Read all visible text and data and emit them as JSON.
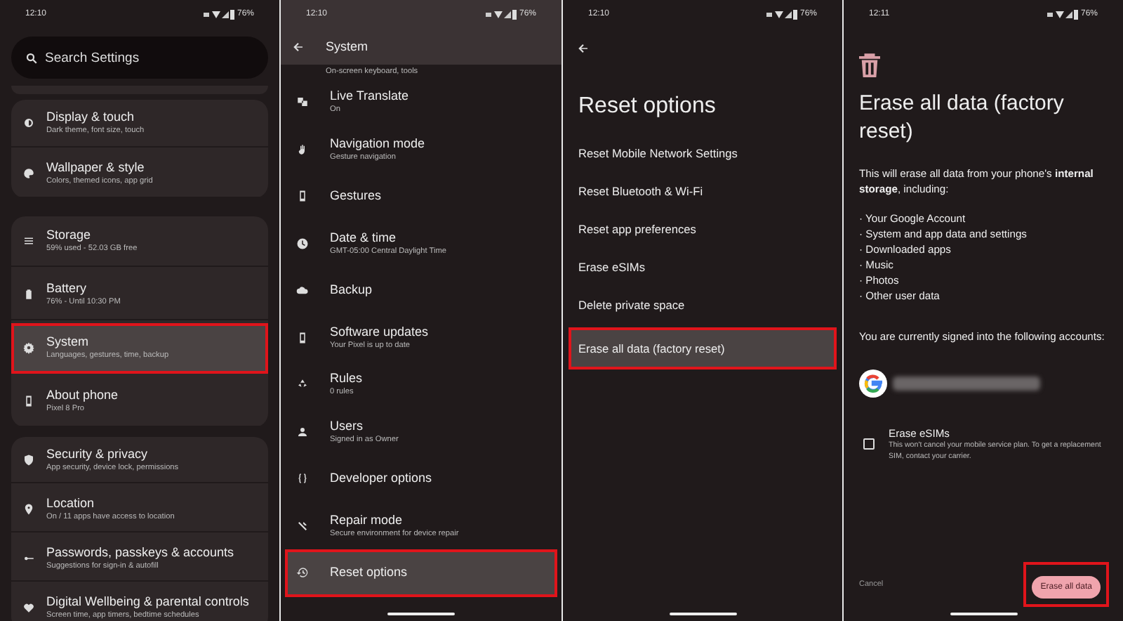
{
  "settings_screen": {
    "status_bar": {
      "time": "12:10",
      "battery": "76%"
    },
    "search": {
      "placeholder": "Search Settings"
    },
    "groups": [
      {
        "items": [
          {
            "title": "Display & touch",
            "subtitle": "Dark theme, font size, touch",
            "highlighted": false
          },
          {
            "title": "Wallpaper & style",
            "subtitle": "Colors, themed icons, app grid",
            "highlighted": false
          }
        ]
      },
      {
        "items": [
          {
            "title": "Storage",
            "subtitle": "59% used - 52.03 GB free",
            "highlighted": false
          },
          {
            "title": "Battery",
            "subtitle": "76% - Until 10:30 PM",
            "highlighted": false
          },
          {
            "title": "System",
            "subtitle": "Languages, gestures, time, backup",
            "highlighted": true
          },
          {
            "title": "About phone",
            "subtitle": "Pixel 8 Pro",
            "highlighted": false
          }
        ]
      },
      {
        "items": [
          {
            "title": "Security & privacy",
            "subtitle": "App security, device lock, permissions",
            "highlighted": false
          },
          {
            "title": "Location",
            "subtitle": "On / 11 apps have access to location",
            "highlighted": false
          },
          {
            "title": "Passwords, passkeys & accounts",
            "subtitle": "Suggestions for sign-in & autofill",
            "highlighted": false
          },
          {
            "title": "Digital Wellbeing & parental controls",
            "subtitle": "Screen time, app timers, bedtime schedules",
            "highlighted": false
          }
        ]
      }
    ]
  },
  "system_screen": {
    "status_bar": {
      "time": "12:10",
      "battery": "76%"
    },
    "title": "System",
    "partial_subtitle": "On-screen keyboard, tools",
    "items": [
      {
        "title": "Live Translate",
        "subtitle": "On",
        "highlighted": false
      },
      {
        "title": "Navigation mode",
        "subtitle": "Gesture navigation",
        "highlighted": false
      },
      {
        "title": "Gestures",
        "highlighted": false
      },
      {
        "title": "Date & time",
        "subtitle": "GMT-05:00 Central Daylight Time",
        "highlighted": false
      },
      {
        "title": "Backup",
        "highlighted": false
      },
      {
        "title": "Software updates",
        "subtitle": "Your Pixel is up to date",
        "highlighted": false
      },
      {
        "title": "Rules",
        "subtitle": "0 rules",
        "highlighted": false
      },
      {
        "title": "Users",
        "subtitle": "Signed in as Owner",
        "highlighted": false
      },
      {
        "title": "Developer options",
        "highlighted": false
      },
      {
        "title": "Repair mode",
        "subtitle": "Secure environment for device repair",
        "highlighted": false
      },
      {
        "title": "Reset options",
        "highlighted": true
      }
    ]
  },
  "reset_screen": {
    "status_bar": {
      "time": "12:10",
      "battery": "76%"
    },
    "title": "Reset options",
    "items": [
      {
        "title": "Reset Mobile Network Settings",
        "highlighted": false
      },
      {
        "title": "Reset Bluetooth & Wi-Fi",
        "highlighted": false
      },
      {
        "title": "Reset app preferences",
        "highlighted": false
      },
      {
        "title": "Erase eSIMs",
        "highlighted": false
      },
      {
        "title": "Delete private space",
        "highlighted": false
      },
      {
        "title": "Erase all data (factory reset)",
        "highlighted": true
      }
    ]
  },
  "erase_screen": {
    "status_bar": {
      "time": "12:11",
      "battery": "76%"
    },
    "title": "Erase all data (factory reset)",
    "intro": "This will erase all data from your phone's **internal storage**, including:",
    "bullets": [
      "· Your Google Account",
      "· System and app data and settings",
      "· Downloaded apps",
      "· Music",
      "· Photos",
      "· Other user data"
    ],
    "accounts_text": "You are currently signed into the following accounts:",
    "esim_option": {
      "title": "Erase eSIMs",
      "description": "This won't cancel your mobile service plan. To get a replacement SIM, contact your carrier.",
      "checked": false
    },
    "cancel": "Cancel",
    "confirm": {
      "label": "Erase all data",
      "highlighted": true
    }
  }
}
